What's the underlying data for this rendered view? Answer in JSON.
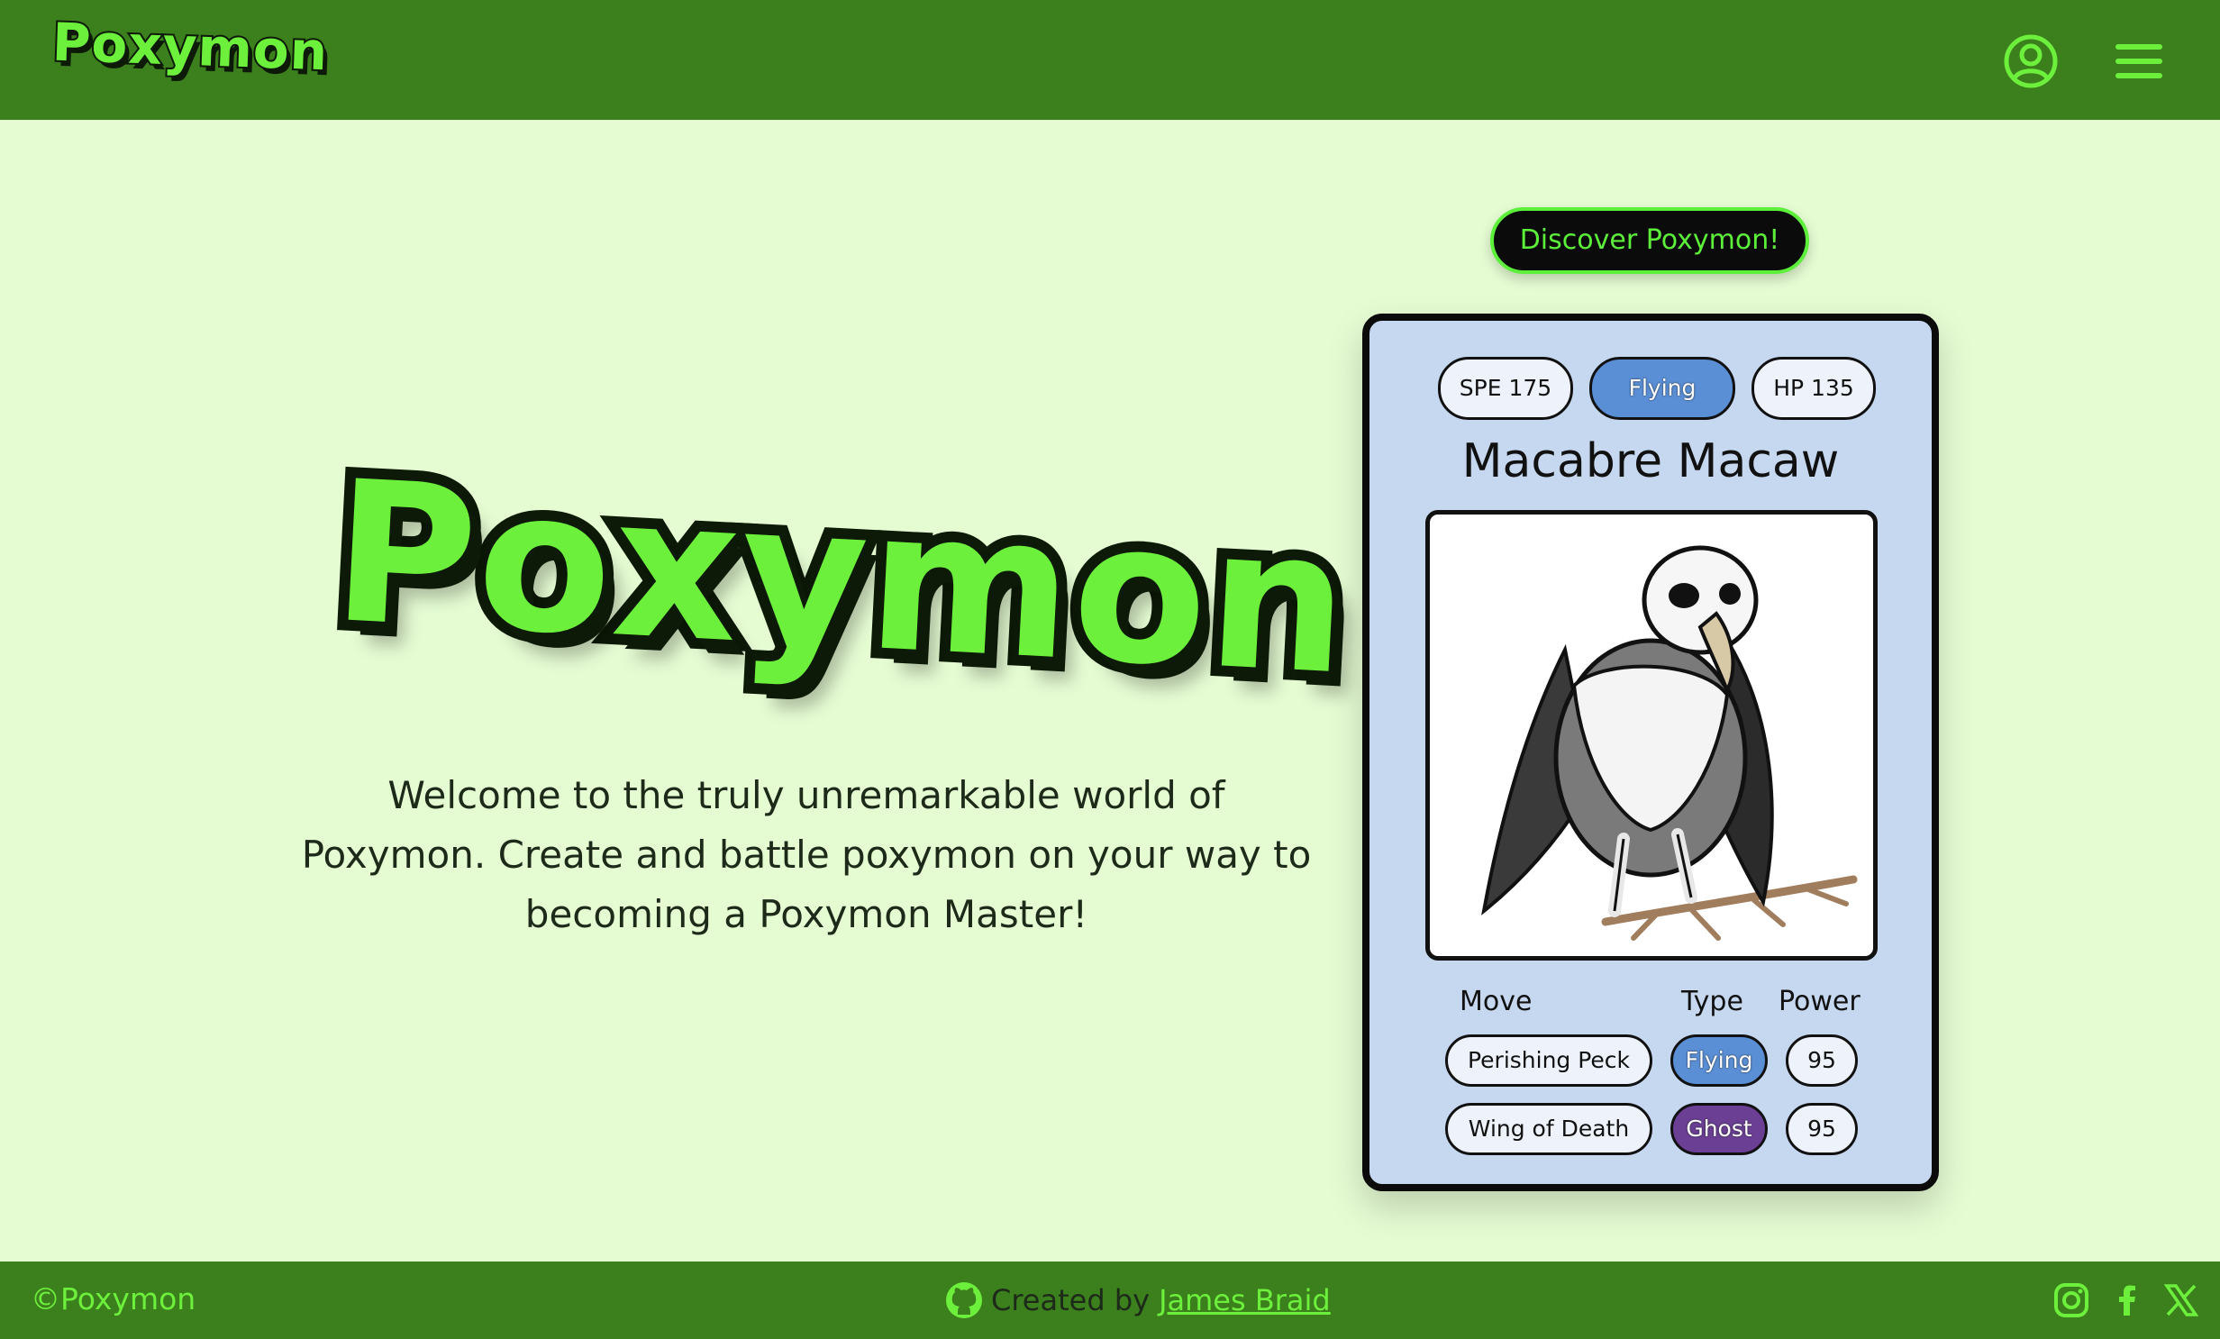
{
  "header": {
    "brand": "Poxymon",
    "account_icon": "user-circle-icon",
    "menu_icon": "hamburger-menu-icon"
  },
  "hero": {
    "logo_text": "Poxymon",
    "welcome_text": "Welcome to the truly unremarkable world of Poxymon. Create and battle poxymon on your way to becoming a Poxymon Master!"
  },
  "discover_button": "Discover Poxymon!",
  "card": {
    "stats": {
      "speed": "SPE 175",
      "type": "Flying",
      "hp": "HP 135"
    },
    "name": "Macabre Macaw",
    "image_icon": "skull-bird-illustration",
    "columns": {
      "move": "Move",
      "type": "Type",
      "power": "Power"
    },
    "moves": [
      {
        "name": "Perishing Peck",
        "type": "Flying",
        "power": "95"
      },
      {
        "name": "Wing of Death",
        "type": "Ghost",
        "power": "95"
      }
    ]
  },
  "footer": {
    "copyright": "©Poxymon",
    "created_by": "Created by",
    "author": "James Braid",
    "github_icon": "github-icon",
    "social_icons": [
      "instagram-icon",
      "facebook-icon",
      "x-icon"
    ]
  },
  "colors": {
    "header_green": "#3c7f1d",
    "accent_green": "#6cf03c",
    "page_bg": "#e5fcd3",
    "card_bg": "#c6d8f0",
    "flying": "#5a8fd6",
    "ghost": "#6a3f94"
  }
}
